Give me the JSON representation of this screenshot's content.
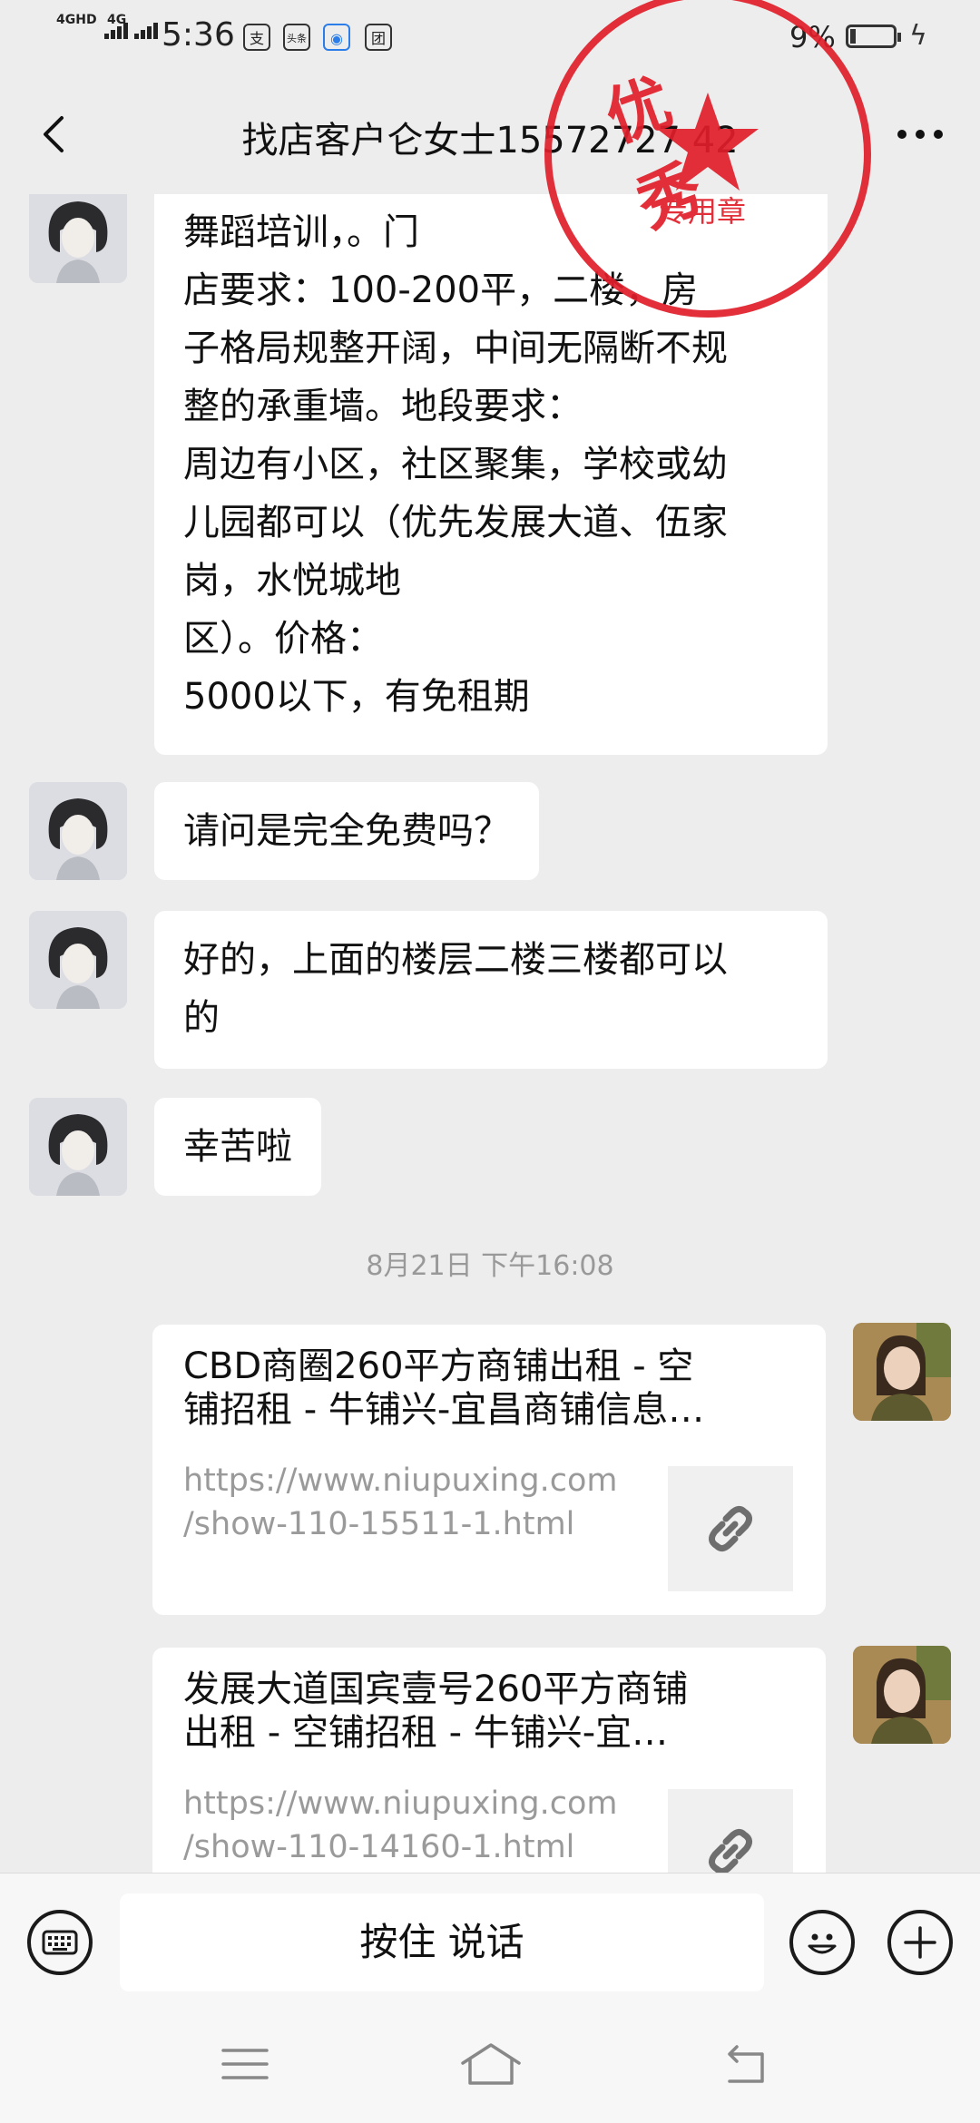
{
  "status_bar": {
    "network1": "4GHD",
    "network2": "4G",
    "time": "5:36",
    "icons": [
      "alipay-icon",
      "toutiao-icon",
      "wifi-icon",
      "tuan-icon"
    ],
    "icon_labels": [
      "支",
      "头条",
      "◉",
      "团"
    ],
    "battery": "9%"
  },
  "header": {
    "title": "找店客户仑女士15572727 42"
  },
  "messages": {
    "m1_lines": [
      [
        "舞蹈培训，。",
        "门"
      ],
      [
        "店要求：100-200平，二楼，房"
      ],
      [
        "子格局规整开阔，中间无隔断不规"
      ],
      [
        "整的承重墙。",
        "地段要求："
      ],
      [
        "周边有小区，社区聚集，学校或幼"
      ],
      [
        "儿园都可以（优先发展大道、伍家"
      ],
      [
        "岗，水悦城地"
      ],
      [
        "区）。",
        "价格："
      ],
      [
        "5000以下，有免租期"
      ]
    ],
    "m2": "请问是完全免费吗？",
    "m3_lines": [
      "好的，上面的楼层二楼三楼都可以",
      "的"
    ],
    "m4": "幸苦啦",
    "timestamp": "8月21日 下午16:08",
    "link1": {
      "title_lines": [
        "CBD商圈260平方商铺出租 - 空",
        "铺招租 - 牛铺兴-宜昌商铺信息…"
      ],
      "url_lines": [
        "https://www.niupuxing.com",
        "/show-110-15511-1.html"
      ]
    },
    "link2": {
      "title_lines": [
        "发展大道国宾壹号260平方商铺",
        "出租 - 空铺招租 - 牛铺兴-宜…"
      ],
      "url_lines": [
        "https://www.niupuxing.com",
        "/show-110-14160-1.html"
      ]
    }
  },
  "input": {
    "voice_label": "按住 说话"
  },
  "stamp": {
    "top": "优 秀",
    "bottom": "专用章"
  },
  "colors": {
    "background": "#ededed",
    "bubble": "#ffffff",
    "stamp": "#e01e2a",
    "url": "#9a9a9a"
  }
}
